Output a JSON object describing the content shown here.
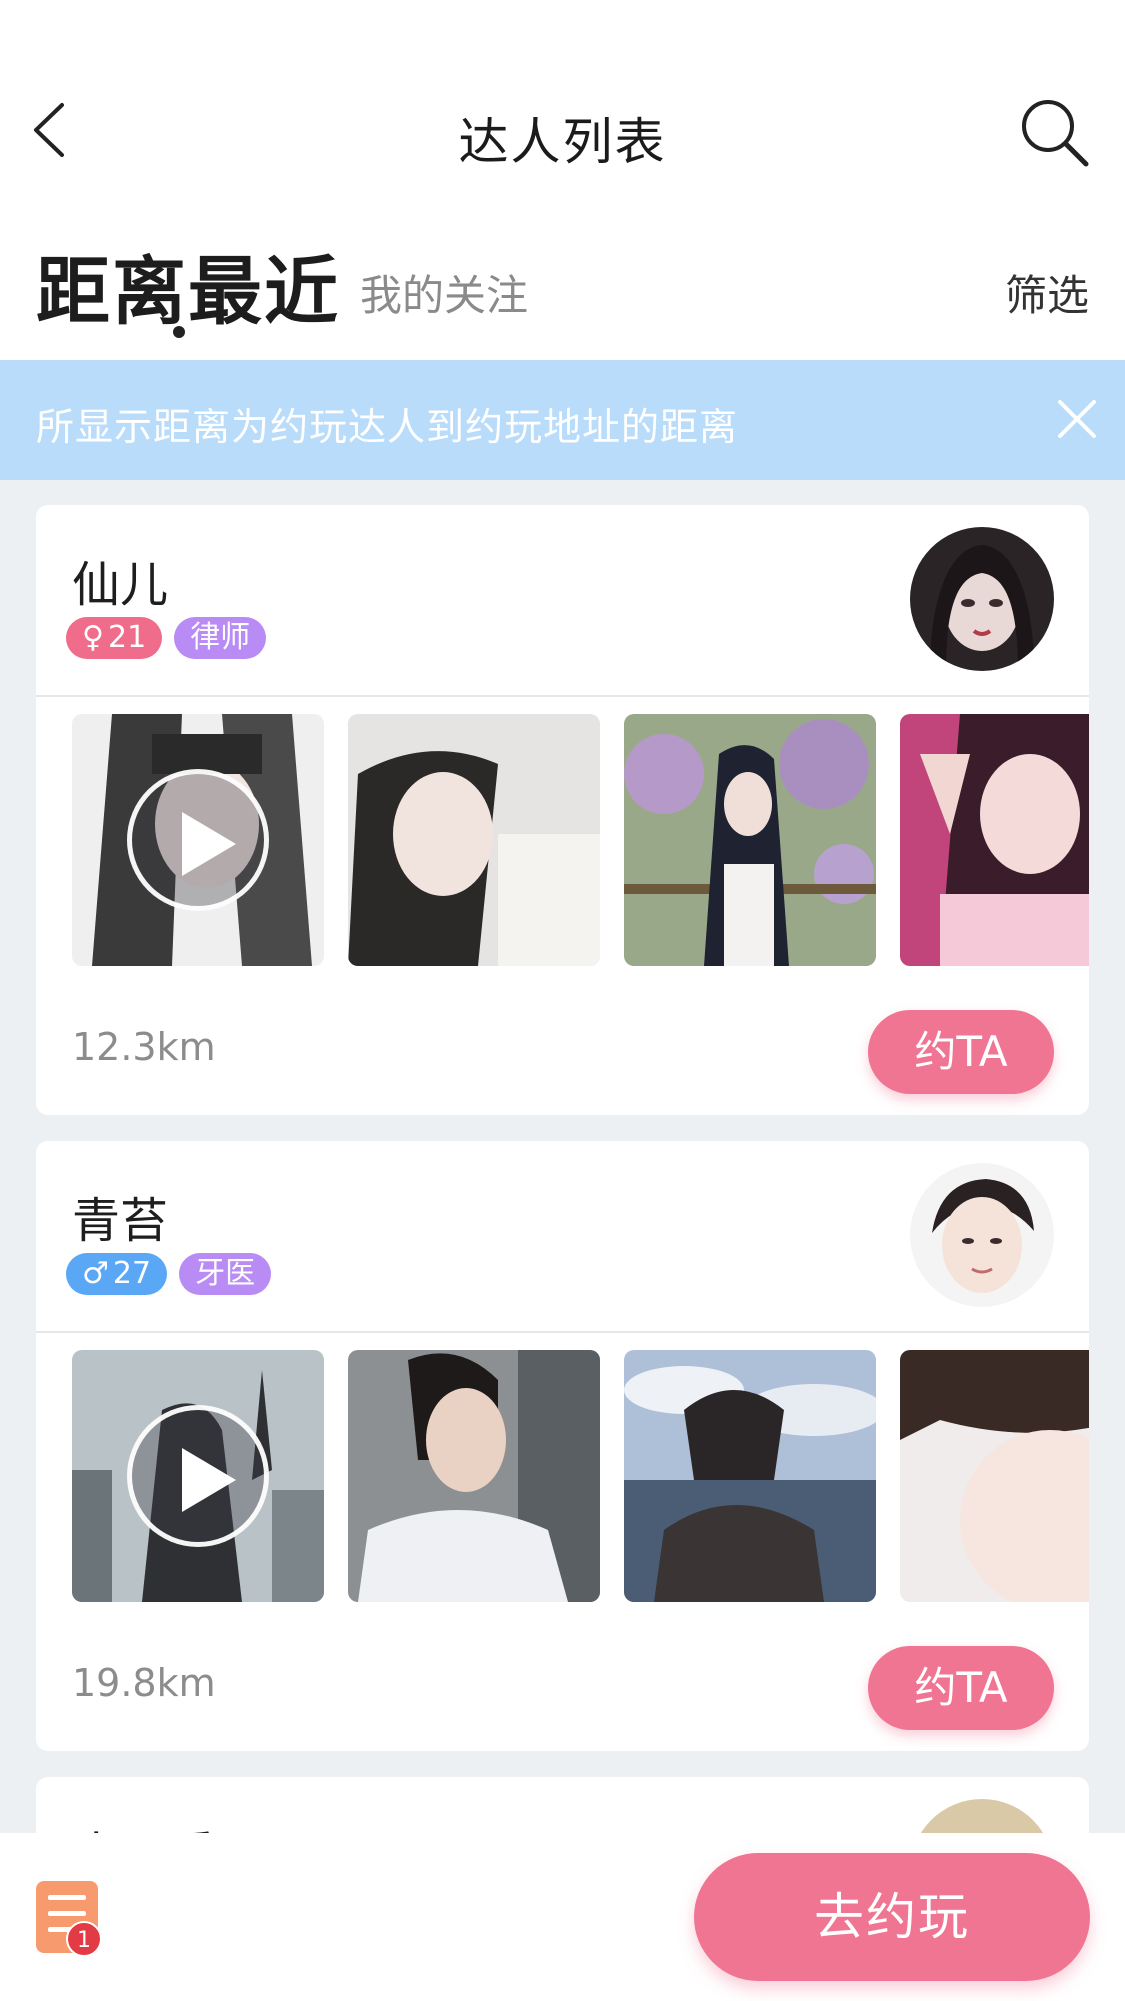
{
  "header": {
    "title": "达人列表",
    "back_icon": "back-chevron-icon",
    "search_icon": "search-icon"
  },
  "tabs": {
    "active": "距离最近",
    "inactive": "我的关注",
    "filter": "筛选"
  },
  "notice": {
    "text": "所显示距离为约玩达人到约玩地址的距离",
    "close_icon": "close-icon"
  },
  "cards": [
    {
      "name": "仙儿",
      "gender_symbol": "♀",
      "age": "21",
      "job": "律师",
      "distance": "12.3km",
      "button": "约TA"
    },
    {
      "name": "青苔",
      "gender_symbol": "♂",
      "age": "27",
      "job": "牙医",
      "distance": "19.8km",
      "button": "约TA"
    },
    {
      "name": "小可爱"
    }
  ],
  "bottom": {
    "order_badge": "1",
    "go_button": "去约玩"
  },
  "colors": {
    "accent_pink": "#f07592",
    "notice_blue": "#b8dcfa",
    "tag_female": "#ef6c8b",
    "tag_male": "#5aa7f6",
    "tag_job": "#b98cf5",
    "badge_red": "#e33b45"
  }
}
